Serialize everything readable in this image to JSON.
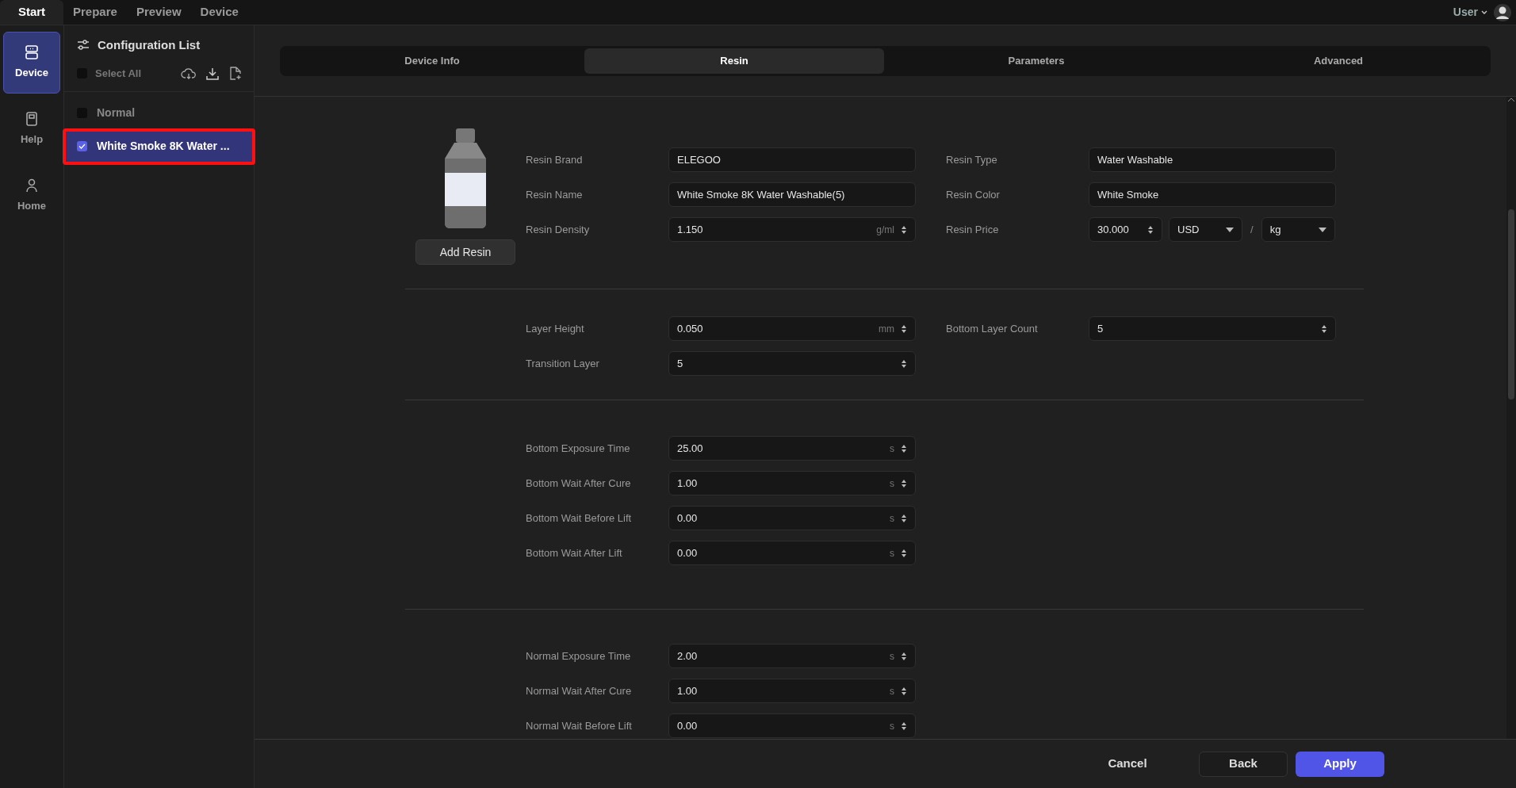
{
  "top_tabs": [
    {
      "label": "Start",
      "selected": true
    },
    {
      "label": "Prepare",
      "selected": false
    },
    {
      "label": "Preview",
      "selected": false
    },
    {
      "label": "Device",
      "selected": false
    }
  ],
  "user": {
    "label": "User"
  },
  "rail": [
    {
      "label": "Device",
      "selected": true,
      "kind": "device"
    },
    {
      "label": "Help",
      "selected": false,
      "kind": "help"
    },
    {
      "label": "Home",
      "selected": false,
      "kind": "home"
    }
  ],
  "config": {
    "title": "Configuration List",
    "select_all": {
      "label": "Select All",
      "checked": false
    },
    "items": [
      {
        "label": "Normal",
        "checked": false,
        "selected": false,
        "highlighted": false
      },
      {
        "label": "White Smoke 8K Water ...",
        "checked": true,
        "selected": true,
        "highlighted": true
      }
    ]
  },
  "tabs": [
    {
      "label": "Device Info",
      "selected": false
    },
    {
      "label": "Resin",
      "selected": true
    },
    {
      "label": "Parameters",
      "selected": false
    },
    {
      "label": "Advanced",
      "selected": false
    }
  ],
  "add_resin": "Add Resin",
  "sections": [
    {
      "rows": [
        [
          {
            "kind": "text",
            "label": "Resin Brand",
            "value": "ELEGOO"
          },
          {
            "kind": "text",
            "label": "Resin Type",
            "value": "Water Washable"
          }
        ],
        [
          {
            "kind": "text",
            "label": "Resin Name",
            "value": "White Smoke 8K Water Washable(5)"
          },
          {
            "kind": "text",
            "label": "Resin Color",
            "value": "White Smoke"
          }
        ],
        [
          {
            "kind": "spin",
            "label": "Resin Density",
            "value": "1.150",
            "unit": "g/ml"
          },
          {
            "kind": "price",
            "label": "Resin Price",
            "value": "30.000",
            "currency": "USD",
            "separator": "/",
            "per": "kg"
          }
        ]
      ]
    },
    {
      "rows": [
        [
          {
            "kind": "spin",
            "label": "Layer Height",
            "value": "0.050",
            "unit": "mm"
          },
          {
            "kind": "spin",
            "label": "Bottom Layer Count",
            "value": "5"
          }
        ],
        [
          {
            "kind": "spin",
            "label": "Transition Layer",
            "value": "5"
          }
        ]
      ]
    },
    {
      "rows": [
        [
          {
            "kind": "spin",
            "label": "Bottom Exposure Time",
            "value": "25.00",
            "unit": "s"
          }
        ],
        [
          {
            "kind": "spin",
            "label": "Bottom Wait After Cure",
            "value": "1.00",
            "unit": "s"
          }
        ],
        [
          {
            "kind": "spin",
            "label": "Bottom Wait Before Lift",
            "value": "0.00",
            "unit": "s"
          }
        ],
        [
          {
            "kind": "spin",
            "label": "Bottom Wait After Lift",
            "value": "0.00",
            "unit": "s"
          }
        ]
      ]
    },
    {
      "rows": [
        [
          {
            "kind": "spin",
            "label": "Normal Exposure Time",
            "value": "2.00",
            "unit": "s"
          }
        ],
        [
          {
            "kind": "spin",
            "label": "Normal Wait After Cure",
            "value": "1.00",
            "unit": "s"
          }
        ],
        [
          {
            "kind": "spin",
            "label": "Normal Wait Before Lift",
            "value": "0.00",
            "unit": "s"
          }
        ]
      ]
    }
  ],
  "footer": [
    {
      "label": "Cancel",
      "kind": "plain"
    },
    {
      "label": "Back",
      "kind": "outline"
    },
    {
      "label": "Apply",
      "kind": "primary"
    }
  ]
}
